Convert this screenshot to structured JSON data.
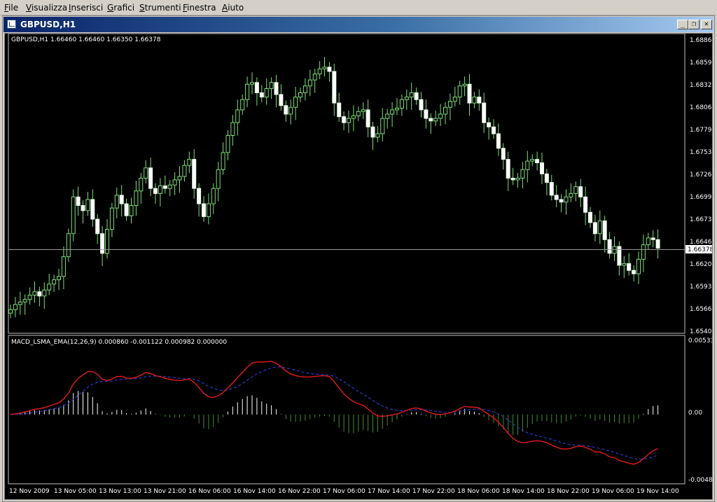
{
  "menu": [
    "File",
    "Visualizza",
    "Inserisci",
    "Grafici",
    "Strumenti",
    "Finestra",
    "Aiuto"
  ],
  "window": {
    "title": "GBPUSD,H1",
    "minimize_label": "_",
    "restore_label": "❐",
    "close_label": "✕"
  },
  "price_panel": {
    "info": "GBPUSD,H1  1.66460 1.66460 1.66350 1.66378",
    "y_ticks": [
      "1.68860",
      "1.68590",
      "1.68325",
      "1.68060",
      "1.67795",
      "1.67530",
      "1.67260",
      "1.66995",
      "1.66730",
      "1.66465",
      "1.66200",
      "1.65935",
      "1.65665",
      "1.65400"
    ],
    "current_price": "1.66378"
  },
  "indicator_panel": {
    "info": "MACD_LSMA_EMA(12,26,9) 0.000860 -0.001122 0.000982 0.000000",
    "y_ticks": [
      "0.005332",
      "0.00",
      "-0.00483"
    ]
  },
  "x_ticks": [
    "12 Nov 2009",
    "13 Nov 05:00",
    "13 Nov 13:00",
    "13 Nov 21:00",
    "16 Nov 06:00",
    "16 Nov 14:00",
    "16 Nov 22:00",
    "17 Nov 06:00",
    "17 Nov 14:00",
    "17 Nov 22:00",
    "18 Nov 06:00",
    "18 Nov 14:00",
    "18 Nov 22:00",
    "19 Nov 06:00",
    "19 Nov 14:00"
  ],
  "chart_data": {
    "type": "candlestick",
    "symbol": "GBPUSD",
    "timeframe": "H1",
    "price_range": [
      1.654,
      1.6886
    ],
    "closes": [
      1.6566,
      1.6572,
      1.6575,
      1.6578,
      1.6583,
      1.6587,
      1.6582,
      1.6589,
      1.6596,
      1.6601,
      1.6605,
      1.6628,
      1.6655,
      1.6698,
      1.6688,
      1.6682,
      1.6695,
      1.6672,
      1.6655,
      1.6632,
      1.666,
      1.6685,
      1.67,
      1.669,
      1.6676,
      1.6688,
      1.6705,
      1.672,
      1.6732,
      1.6708,
      1.6702,
      1.6711,
      1.6708,
      1.6712,
      1.6718,
      1.6722,
      1.6735,
      1.6742,
      1.6708,
      1.669,
      1.6675,
      1.669,
      1.6708,
      1.673,
      1.675,
      1.677,
      1.6785,
      1.68,
      1.6812,
      1.683,
      1.6832,
      1.682,
      1.6815,
      1.6825,
      1.6832,
      1.6818,
      1.6805,
      1.6795,
      1.6803,
      1.6815,
      1.682,
      1.6828,
      1.6835,
      1.6842,
      1.6848,
      1.685,
      1.6845,
      1.6808,
      1.6792,
      1.6785,
      1.679,
      1.6793,
      1.6798,
      1.68,
      1.678,
      1.6768,
      1.6772,
      1.679,
      1.6795,
      1.68,
      1.6802,
      1.6812,
      1.6815,
      1.682,
      1.6812,
      1.68,
      1.679,
      1.6787,
      1.679,
      1.6795,
      1.6803,
      1.681,
      1.6815,
      1.6828,
      1.683,
      1.6808,
      1.6815,
      1.6808,
      1.6785,
      1.678,
      1.6772,
      1.6755,
      1.6742,
      1.672,
      1.6718,
      1.672,
      1.673,
      1.674,
      1.6742,
      1.6738,
      1.6725,
      1.6715,
      1.67,
      1.6695,
      1.6692,
      1.6698,
      1.6702,
      1.671,
      1.6698,
      1.668,
      1.6668,
      1.6655,
      1.667,
      1.6648,
      1.6632,
      1.664,
      1.6618,
      1.662,
      1.6612,
      1.6608,
      1.6625,
      1.6642,
      1.665,
      1.6648,
      1.6638
    ]
  }
}
